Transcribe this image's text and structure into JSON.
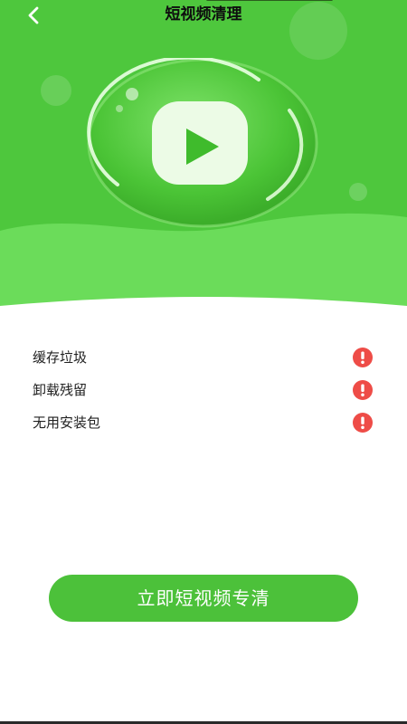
{
  "header": {
    "title": "短视频清理",
    "back_icon": "chevron-left-icon"
  },
  "hero": {
    "icon": "video-play-icon",
    "background_color": "#4ec73d",
    "accent_color": "#6bdc5a"
  },
  "scan_items": [
    {
      "label": "缓存垃圾",
      "status_icon": "warning-icon"
    },
    {
      "label": "卸载残留",
      "status_icon": "warning-icon"
    },
    {
      "label": "无用安装包",
      "status_icon": "warning-icon"
    }
  ],
  "warning_color": "#ee4c47",
  "action": {
    "clean_button_label": "立即短视频专清",
    "button_color": "#4cc13a"
  }
}
